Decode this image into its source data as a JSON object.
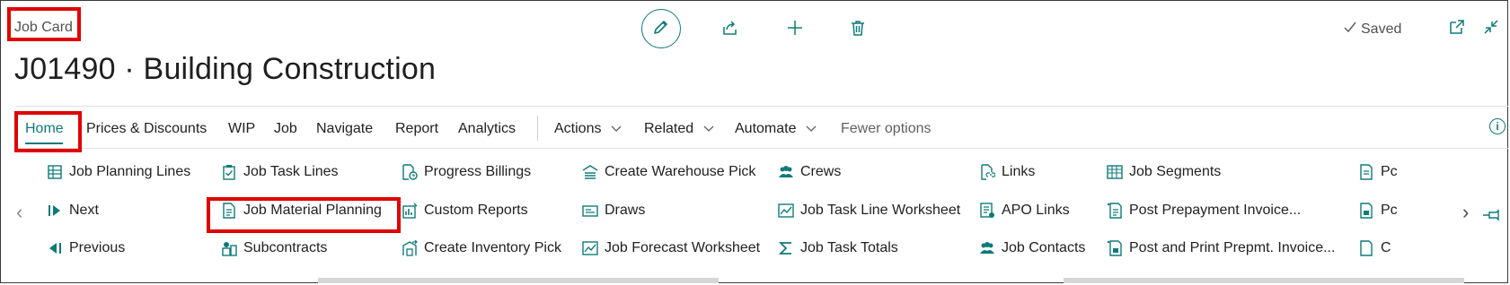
{
  "page": {
    "caption": "Job Card",
    "title": "J01490 · Building Construction",
    "saved_label": "Saved"
  },
  "top_actions": [
    {
      "name": "edit",
      "icon": "pencil-icon"
    },
    {
      "name": "share",
      "icon": "share-icon"
    },
    {
      "name": "new",
      "icon": "plus-icon"
    },
    {
      "name": "delete",
      "icon": "trash-icon"
    }
  ],
  "tabs": [
    {
      "label": "Home",
      "active": true
    },
    {
      "label": "Prices & Discounts"
    },
    {
      "label": "WIP"
    },
    {
      "label": "Job"
    },
    {
      "label": "Navigate"
    },
    {
      "label": "Report"
    },
    {
      "label": "Analytics"
    },
    {
      "label": "Actions",
      "dropdown": true
    },
    {
      "label": "Related",
      "dropdown": true
    },
    {
      "label": "Automate",
      "dropdown": true
    },
    {
      "label": "Fewer options",
      "muted": true
    }
  ],
  "actions": {
    "col1": [
      "Job Planning Lines",
      "Next",
      "Previous"
    ],
    "col2": [
      "Job Task Lines",
      "Job Material Planning",
      "Subcontracts"
    ],
    "col3": [
      "Progress Billings",
      "Custom Reports",
      "Create Inventory Pick"
    ],
    "col4": [
      "Create Warehouse Pick",
      "Draws",
      "Job Forecast Worksheet"
    ],
    "col5": [
      "Crews",
      "Job Task Line Worksheet",
      "Job Task Totals"
    ],
    "col6": [
      "Links",
      "APO Links",
      "Job Contacts"
    ],
    "col7": [
      "Job Segments",
      "Post Prepayment Invoice...",
      "Post and Print Prepmt. Invoice..."
    ],
    "col8": [
      "Pc",
      "Pc",
      "C"
    ]
  },
  "colors": {
    "accent": "#107a7a",
    "highlight": "#e00000"
  }
}
